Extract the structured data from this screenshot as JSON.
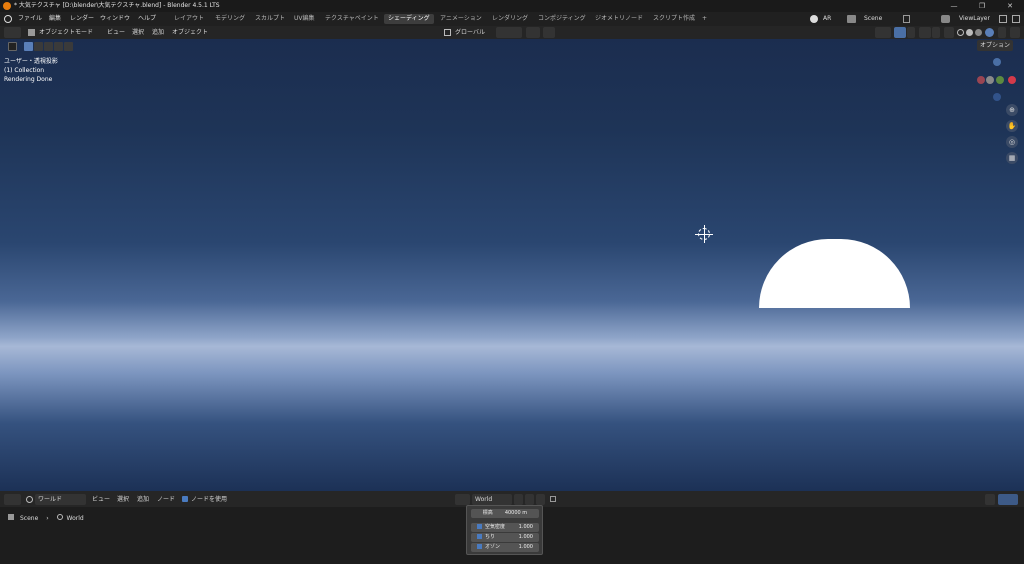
{
  "window": {
    "title": "* 大気テクスチャ [D:\\blender\\大気テクスチャ.blend] - Blender 4.5.1 LTS",
    "controls": [
      "—",
      "❐",
      "✕"
    ]
  },
  "menubar": {
    "menus": [
      "ファイル",
      "編集",
      "レンダー",
      "ウィンドウ",
      "ヘルプ"
    ],
    "workspaces": [
      "レイアウト",
      "モデリング",
      "スカルプト",
      "UV編集",
      "テクスチャペイント",
      "シェーディング",
      "アニメーション",
      "レンダリング",
      "コンポジティング",
      "ジオメトリノード",
      "スクリプト作成",
      "+"
    ],
    "active_workspace": "シェーディング",
    "ar_label": "AR",
    "scene": "Scene",
    "view_layer": "ViewLayer"
  },
  "viewport_header": {
    "mode": "オブジェクトモード",
    "menus": [
      "ビュー",
      "選択",
      "追加",
      "オブジェクト"
    ],
    "transform_orientation": "グローバル",
    "options": "オプション"
  },
  "viewport": {
    "overlay_lines": [
      "ユーザー・透視投影",
      "(1) Collection",
      "Rendering Done"
    ],
    "gizmo_labels": {
      "x": "X",
      "y": "Y",
      "z": "Z"
    },
    "colors": {
      "sky_top": "#1b2d4f",
      "horizon": "#a7b8d6",
      "sun": "#ffffff"
    }
  },
  "node_header": {
    "editor_type": "ワールド",
    "menus": [
      "ビュー",
      "選択",
      "追加",
      "ノード"
    ],
    "use_nodes_label": "ノードを使用",
    "use_nodes_checked": true,
    "world_name": "World"
  },
  "breadcrumb": {
    "scene": "Scene",
    "separator": "›",
    "world": "World"
  },
  "sky_node": {
    "altitude_label": "標高",
    "altitude_value": "40000 m",
    "rows": [
      {
        "label": "空気密度",
        "value": "1.000"
      },
      {
        "label": "ちり",
        "value": "1.000"
      },
      {
        "label": "オゾン",
        "value": "1.000"
      }
    ]
  }
}
